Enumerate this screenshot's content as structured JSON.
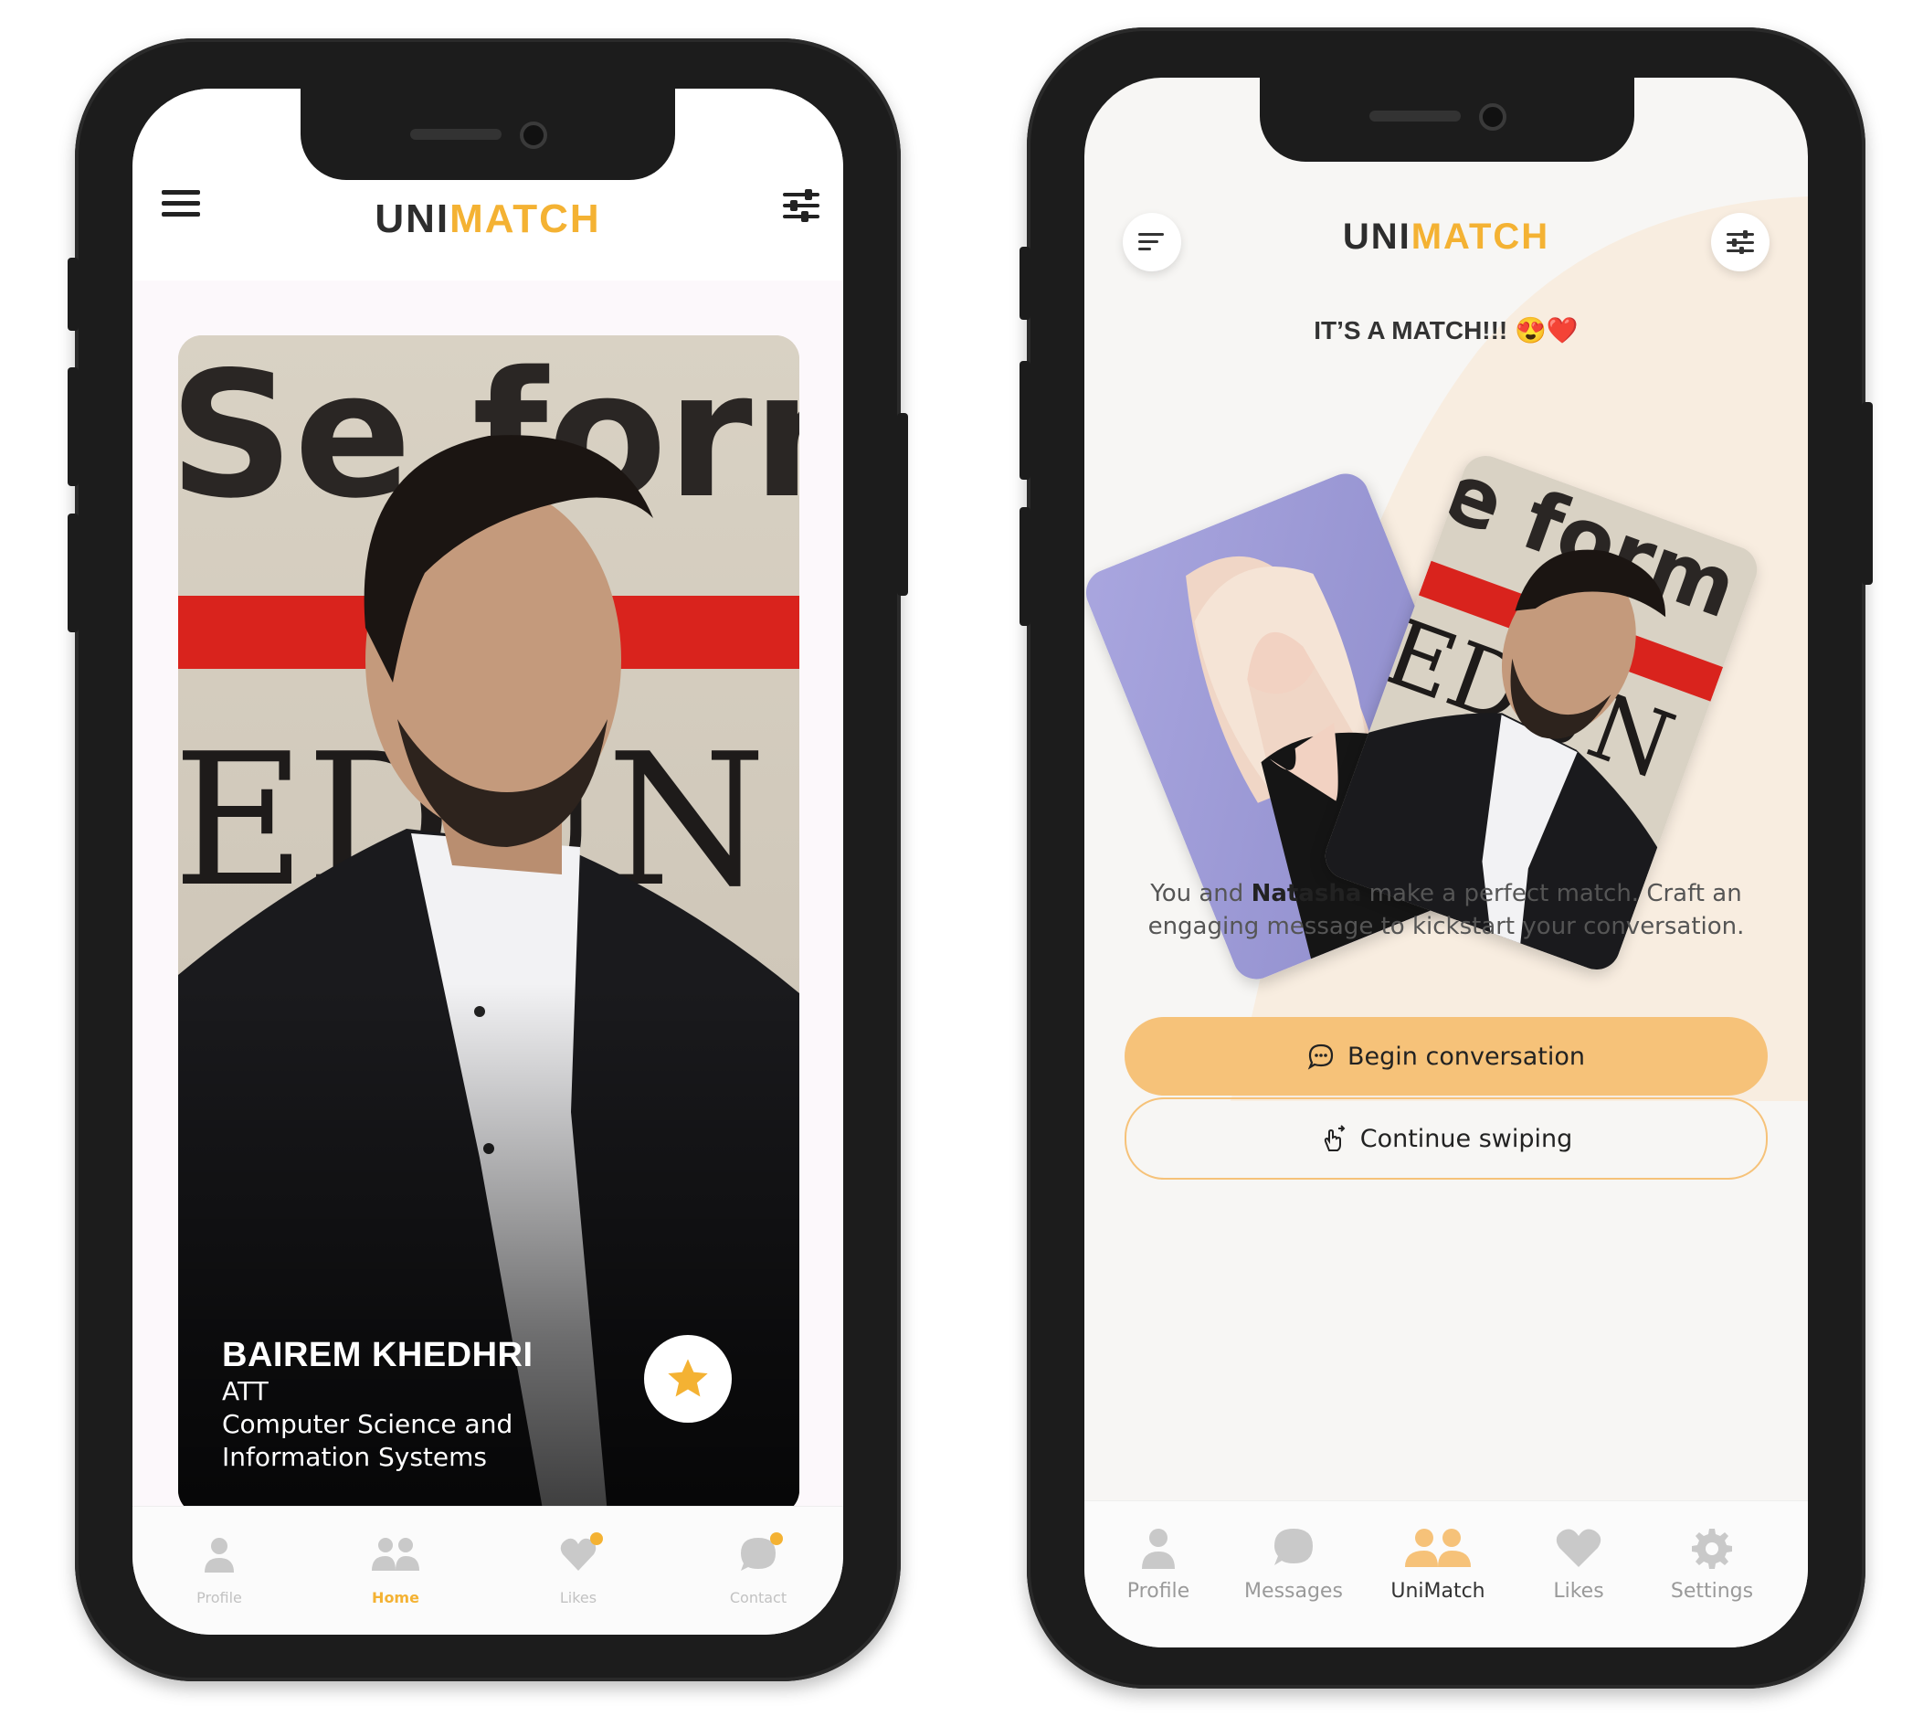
{
  "colors": {
    "brand_accent": "#f4b233",
    "button_fill": "#f6c279",
    "phone_frame": "#1c1c1c"
  },
  "left_screen": {
    "logo": {
      "part1": "UNI",
      "part2": "MATCH"
    },
    "profile": {
      "name": "BAIREM KHEDHRI",
      "line1": "ATT",
      "line2": "Computer Science and",
      "line3": "Information Systems"
    },
    "nav": [
      {
        "label": "Profile",
        "icon": "person-icon",
        "active": false
      },
      {
        "label": "Home",
        "icon": "people-icon",
        "active": true
      },
      {
        "label": "Likes",
        "icon": "heart-icon",
        "active": false,
        "badge": true
      },
      {
        "label": "Contact",
        "icon": "chat-bubble-icon",
        "active": false,
        "badge": true
      }
    ]
  },
  "right_screen": {
    "logo": {
      "part1": "UNI",
      "part2": "MATCH"
    },
    "match_title": "IT’S A MATCH!!! 😍❤️",
    "message": {
      "prefix": "You and ",
      "name": "Natasha",
      "suffix_line1": " make a perfect match. Craft an",
      "line2": "engaging message to kickstart your conversation."
    },
    "buttons": {
      "begin": "Begin conversation",
      "continue": "Continue swiping"
    },
    "nav": [
      {
        "label": "Profile",
        "icon": "person-icon",
        "active": false
      },
      {
        "label": "Messages",
        "icon": "chat-bubble-icon",
        "active": false
      },
      {
        "label": "UniMatch",
        "icon": "people-icon",
        "active": true
      },
      {
        "label": "Likes",
        "icon": "heart-icon",
        "active": false
      },
      {
        "label": "Settings",
        "icon": "gear-icon",
        "active": false
      }
    ]
  }
}
